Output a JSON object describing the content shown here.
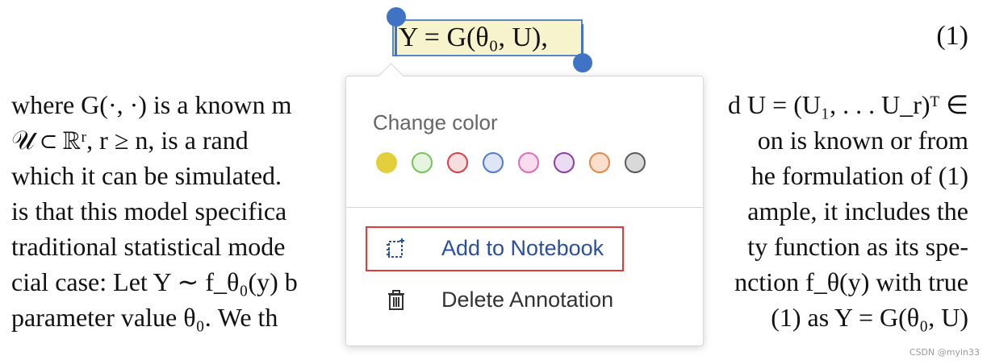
{
  "equation": {
    "text": "Y = G(θ₀, U),",
    "number": "(1)"
  },
  "paragraph": {
    "lines": [
      {
        "left": "where G(·, ·) is a known m",
        "right": "d U = (U₁, . . . U_r)ᵀ ∈"
      },
      {
        "left": "𝒰 ⊂ ℝʳ, r ≥ n, is a rand",
        "right": "on is known or from"
      },
      {
        "left": "which it can be simulated.",
        "right": "he formulation of (1)"
      },
      {
        "left": "is that this model specifica",
        "right": "ample, it includes the"
      },
      {
        "left": "traditional statistical mode",
        "right": "ty function as its spe-"
      },
      {
        "left": "cial case: Let Y ∼ f_θ₀(y) b",
        "right": "nction f_θ(y) with true"
      },
      {
        "left": "parameter value θ₀. We th",
        "right": "(1) as Y = G(θ₀, U)"
      }
    ]
  },
  "popover": {
    "section_title": "Change color",
    "swatches": [
      {
        "name": "yellow",
        "fill": "#e3cf3c",
        "border": "#e3cf3c"
      },
      {
        "name": "green",
        "fill": "#e6f5df",
        "border": "#74c45a"
      },
      {
        "name": "red",
        "fill": "#f7dede",
        "border": "#d9404a"
      },
      {
        "name": "blue",
        "fill": "#dde5f7",
        "border": "#4f7ad0"
      },
      {
        "name": "pink",
        "fill": "#f9dced",
        "border": "#e06cb8"
      },
      {
        "name": "purple",
        "fill": "#eadcf2",
        "border": "#8b3fa6"
      },
      {
        "name": "orange",
        "fill": "#f9dfcc",
        "border": "#e08a4a"
      },
      {
        "name": "gray",
        "fill": "#d9d9d9",
        "border": "#5a5a5a"
      }
    ],
    "menu": {
      "add_notebook": {
        "label": "Add to Notebook",
        "icon": "notebook-add-icon"
      },
      "delete_annotation": {
        "label": "Delete Annotation",
        "icon": "trash-icon"
      }
    }
  },
  "watermark": "CSDN @myin33"
}
